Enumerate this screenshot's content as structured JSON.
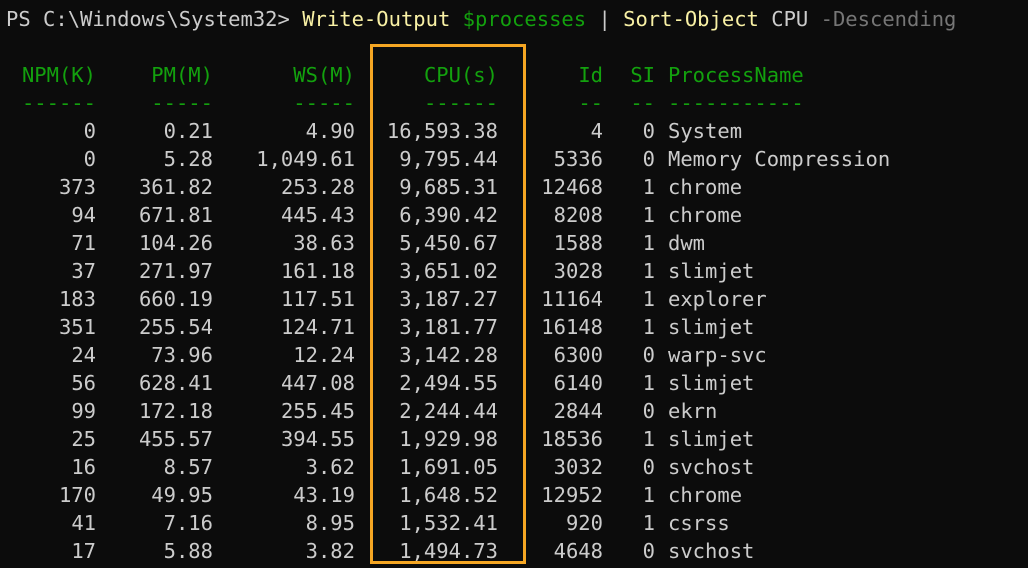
{
  "prompt": {
    "path": "PS C:\\Windows\\System32> ",
    "command": "Write-Output",
    "variable": "$processes",
    "pipe": "|",
    "sort_cmd": "Sort-Object",
    "sort_arg": "CPU",
    "sort_param": "-Descending"
  },
  "table": {
    "headers": [
      "NPM(K)",
      "PM(M)",
      "WS(M)",
      "CPU(s)",
      "Id",
      "SI",
      "ProcessName"
    ],
    "underlines": [
      "------",
      "-----",
      "-----",
      "------",
      "--",
      "--",
      "-----------"
    ],
    "rows": [
      [
        "0",
        "0.21",
        "4.90",
        "16,593.38",
        "4",
        "0",
        "System"
      ],
      [
        "0",
        "5.28",
        "1,049.61",
        "9,795.44",
        "5336",
        "0",
        "Memory Compression"
      ],
      [
        "373",
        "361.82",
        "253.28",
        "9,685.31",
        "12468",
        "1",
        "chrome"
      ],
      [
        "94",
        "671.81",
        "445.43",
        "6,390.42",
        "8208",
        "1",
        "chrome"
      ],
      [
        "71",
        "104.26",
        "38.63",
        "5,450.67",
        "1588",
        "1",
        "dwm"
      ],
      [
        "37",
        "271.97",
        "161.18",
        "3,651.02",
        "3028",
        "1",
        "slimjet"
      ],
      [
        "183",
        "660.19",
        "117.51",
        "3,187.27",
        "11164",
        "1",
        "explorer"
      ],
      [
        "351",
        "255.54",
        "124.71",
        "3,181.77",
        "16148",
        "1",
        "slimjet"
      ],
      [
        "24",
        "73.96",
        "12.24",
        "3,142.28",
        "6300",
        "0",
        "warp-svc"
      ],
      [
        "56",
        "628.41",
        "447.08",
        "2,494.55",
        "6140",
        "1",
        "slimjet"
      ],
      [
        "99",
        "172.18",
        "255.45",
        "2,244.44",
        "2844",
        "0",
        "ekrn"
      ],
      [
        "25",
        "455.57",
        "394.55",
        "1,929.98",
        "18536",
        "1",
        "slimjet"
      ],
      [
        "16",
        "8.57",
        "3.62",
        "1,691.05",
        "3032",
        "0",
        "svchost"
      ],
      [
        "170",
        "49.95",
        "43.19",
        "1,648.52",
        "12952",
        "1",
        "chrome"
      ],
      [
        "41",
        "7.16",
        "8.95",
        "1,532.41",
        "920",
        "1",
        "csrss"
      ],
      [
        "17",
        "5.88",
        "3.82",
        "1,494.73",
        "4648",
        "0",
        "svchost"
      ]
    ]
  },
  "colors": {
    "background": "#0c0c0c",
    "header_green": "#13a10e",
    "command_yellow": "#f9f1a5",
    "highlight_orange": "#f5a623"
  }
}
